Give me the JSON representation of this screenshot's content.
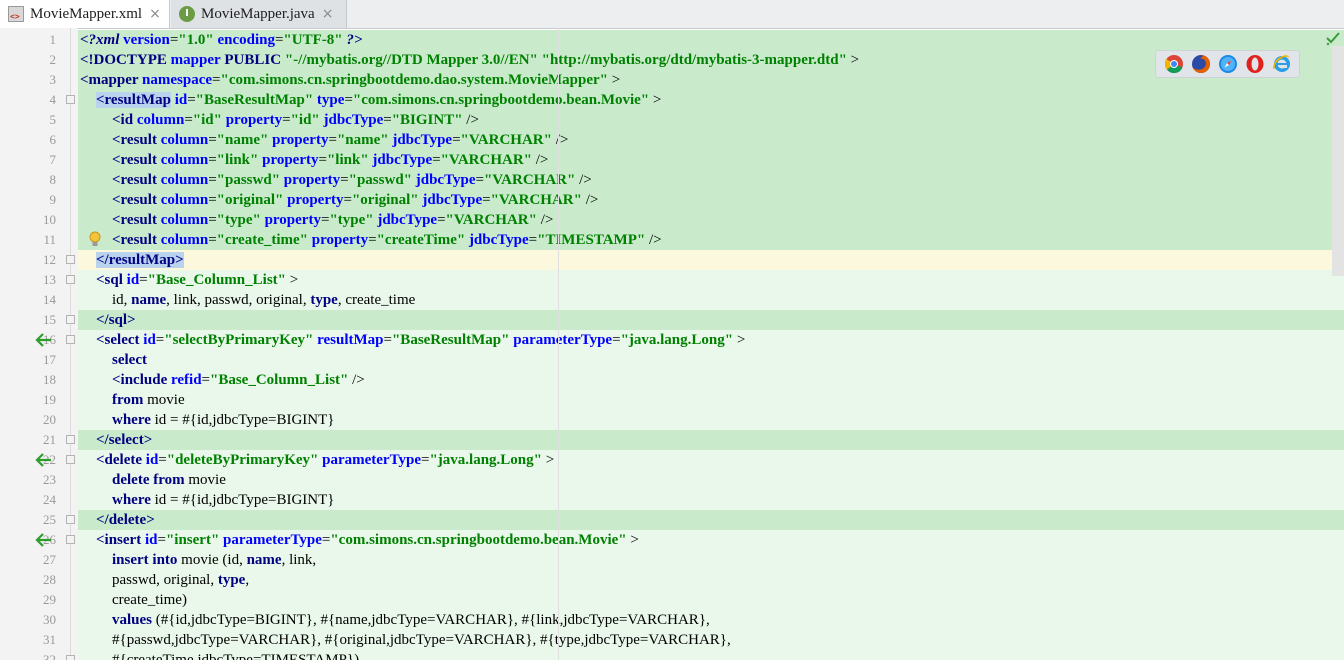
{
  "tabs": [
    {
      "label": "MovieMapper.xml",
      "icon": "xml-file-icon",
      "active": true
    },
    {
      "label": "MovieMapper.java",
      "icon": "java-interface-icon",
      "icon_letter": "I",
      "active": false
    }
  ],
  "close_glyph": "×",
  "browsers": [
    "chrome-icon",
    "firefox-icon",
    "safari-icon",
    "opera-icon",
    "ie-icon"
  ],
  "lines": [
    {
      "n": "1",
      "tokens": [
        [
          "pi",
          "<?xml "
        ],
        [
          "at",
          "version"
        ],
        [
          "pl",
          "="
        ],
        [
          "vl",
          "\"1.0\""
        ],
        [
          "pl",
          " "
        ],
        [
          "at",
          "encoding"
        ],
        [
          "pl",
          "="
        ],
        [
          "vl",
          "\"UTF-8\""
        ],
        [
          "pi",
          " ?>"
        ]
      ]
    },
    {
      "n": "2",
      "tokens": [
        [
          "tg",
          "<!DOCTYPE "
        ],
        [
          "at",
          "mapper"
        ],
        [
          "pl",
          " "
        ],
        [
          "tg",
          "PUBLIC"
        ],
        [
          "pl",
          " "
        ],
        [
          "vl",
          "\"-//mybatis.org//DTD Mapper 3.0//EN\""
        ],
        [
          "pl",
          " "
        ],
        [
          "vl",
          "\"http://mybatis.org/dtd/mybatis-3-mapper.dtd\""
        ],
        [
          "pl",
          " >"
        ]
      ]
    },
    {
      "n": "3",
      "tokens": [
        [
          "tg",
          "<mapper "
        ],
        [
          "at",
          "namespace"
        ],
        [
          "pl",
          "="
        ],
        [
          "vl",
          "\"com.simons.cn.springbootdemo.dao.system.MovieMapper\""
        ],
        [
          "pl",
          " >"
        ]
      ]
    },
    {
      "n": "4",
      "tokens": [
        [
          "tgh",
          "<resultMap"
        ],
        [
          "pl",
          " "
        ],
        [
          "at",
          "id"
        ],
        [
          "pl",
          "="
        ],
        [
          "vl",
          "\"BaseResultMap\""
        ],
        [
          "pl",
          " "
        ],
        [
          "at",
          "type"
        ],
        [
          "pl",
          "="
        ],
        [
          "vl",
          "\"com.simons.cn.springbootdemo.bean.Movie\""
        ],
        [
          "pl",
          " >"
        ]
      ]
    },
    {
      "n": "5",
      "tokens": [
        [
          "tg",
          "<id "
        ],
        [
          "at",
          "column"
        ],
        [
          "pl",
          "="
        ],
        [
          "vl",
          "\"id\""
        ],
        [
          "pl",
          " "
        ],
        [
          "at",
          "property"
        ],
        [
          "pl",
          "="
        ],
        [
          "vl",
          "\"id\""
        ],
        [
          "pl",
          " "
        ],
        [
          "at",
          "jdbcType"
        ],
        [
          "pl",
          "="
        ],
        [
          "vl",
          "\"BIGINT\""
        ],
        [
          "pl",
          " />"
        ]
      ]
    },
    {
      "n": "6",
      "tokens": [
        [
          "tg",
          "<result "
        ],
        [
          "at",
          "column"
        ],
        [
          "pl",
          "="
        ],
        [
          "vl",
          "\"name\""
        ],
        [
          "pl",
          " "
        ],
        [
          "at",
          "property"
        ],
        [
          "pl",
          "="
        ],
        [
          "vl",
          "\"name\""
        ],
        [
          "pl",
          " "
        ],
        [
          "at",
          "jdbcType"
        ],
        [
          "pl",
          "="
        ],
        [
          "vl",
          "\"VARCHAR\""
        ],
        [
          "pl",
          " />"
        ]
      ]
    },
    {
      "n": "7",
      "tokens": [
        [
          "tg",
          "<result "
        ],
        [
          "at",
          "column"
        ],
        [
          "pl",
          "="
        ],
        [
          "vl",
          "\"link\""
        ],
        [
          "pl",
          " "
        ],
        [
          "at",
          "property"
        ],
        [
          "pl",
          "="
        ],
        [
          "vl",
          "\"link\""
        ],
        [
          "pl",
          " "
        ],
        [
          "at",
          "jdbcType"
        ],
        [
          "pl",
          "="
        ],
        [
          "vl",
          "\"VARCHAR\""
        ],
        [
          "pl",
          " />"
        ]
      ]
    },
    {
      "n": "8",
      "tokens": [
        [
          "tg",
          "<result "
        ],
        [
          "at",
          "column"
        ],
        [
          "pl",
          "="
        ],
        [
          "vl",
          "\"passwd\""
        ],
        [
          "pl",
          " "
        ],
        [
          "at",
          "property"
        ],
        [
          "pl",
          "="
        ],
        [
          "vl",
          "\"passwd\""
        ],
        [
          "pl",
          " "
        ],
        [
          "at",
          "jdbcType"
        ],
        [
          "pl",
          "="
        ],
        [
          "vl",
          "\"VARCHAR\""
        ],
        [
          "pl",
          " />"
        ]
      ]
    },
    {
      "n": "9",
      "tokens": [
        [
          "tg",
          "<result "
        ],
        [
          "at",
          "column"
        ],
        [
          "pl",
          "="
        ],
        [
          "vl",
          "\"original\""
        ],
        [
          "pl",
          " "
        ],
        [
          "at",
          "property"
        ],
        [
          "pl",
          "="
        ],
        [
          "vl",
          "\"original\""
        ],
        [
          "pl",
          " "
        ],
        [
          "at",
          "jdbcType"
        ],
        [
          "pl",
          "="
        ],
        [
          "vl",
          "\"VARCHAR\""
        ],
        [
          "pl",
          " />"
        ]
      ]
    },
    {
      "n": "10",
      "tokens": [
        [
          "tg",
          "<result "
        ],
        [
          "at",
          "column"
        ],
        [
          "pl",
          "="
        ],
        [
          "vl",
          "\"type\""
        ],
        [
          "pl",
          " "
        ],
        [
          "at",
          "property"
        ],
        [
          "pl",
          "="
        ],
        [
          "vl",
          "\"type\""
        ],
        [
          "pl",
          " "
        ],
        [
          "at",
          "jdbcType"
        ],
        [
          "pl",
          "="
        ],
        [
          "vl",
          "\"VARCHAR\""
        ],
        [
          "pl",
          " />"
        ]
      ]
    },
    {
      "n": "11",
      "tokens": [
        [
          "tg",
          "<result "
        ],
        [
          "at",
          "column"
        ],
        [
          "pl",
          "="
        ],
        [
          "vl",
          "\"create_time\""
        ],
        [
          "pl",
          " "
        ],
        [
          "at",
          "property"
        ],
        [
          "pl",
          "="
        ],
        [
          "vl",
          "\"createTime\""
        ],
        [
          "pl",
          " "
        ],
        [
          "at",
          "jdbcType"
        ],
        [
          "pl",
          "="
        ],
        [
          "vl",
          "\"TIMESTAMP\""
        ],
        [
          "pl",
          " />"
        ]
      ]
    },
    {
      "n": "12",
      "tokens": [
        [
          "tgh",
          "</resultMap>"
        ]
      ]
    },
    {
      "n": "13",
      "tokens": [
        [
          "tg",
          "<sql "
        ],
        [
          "at",
          "id"
        ],
        [
          "pl",
          "="
        ],
        [
          "vl",
          "\"Base_Column_List\""
        ],
        [
          "pl",
          " >"
        ]
      ]
    },
    {
      "n": "14",
      "tokens": [
        [
          "pl",
          "id, "
        ],
        [
          "kw",
          "name"
        ],
        [
          "pl",
          ", link, passwd, original, "
        ],
        [
          "kw",
          "type"
        ],
        [
          "pl",
          ", create_time"
        ]
      ]
    },
    {
      "n": "15",
      "tokens": [
        [
          "tg",
          "</sql>"
        ]
      ]
    },
    {
      "n": "16",
      "tokens": [
        [
          "tg",
          "<select "
        ],
        [
          "at",
          "id"
        ],
        [
          "pl",
          "="
        ],
        [
          "vl",
          "\"selectByPrimaryKey\""
        ],
        [
          "pl",
          " "
        ],
        [
          "at",
          "resultMap"
        ],
        [
          "pl",
          "="
        ],
        [
          "vl",
          "\"BaseResultMap\""
        ],
        [
          "pl",
          " "
        ],
        [
          "at",
          "parameterType"
        ],
        [
          "pl",
          "="
        ],
        [
          "vl",
          "\"java.lang.Long\""
        ],
        [
          "pl",
          " >"
        ]
      ]
    },
    {
      "n": "17",
      "tokens": [
        [
          "kw",
          "select"
        ]
      ]
    },
    {
      "n": "18",
      "tokens": [
        [
          "tg",
          "<include "
        ],
        [
          "at",
          "refid"
        ],
        [
          "pl",
          "="
        ],
        [
          "vl",
          "\"Base_Column_List\""
        ],
        [
          "pl",
          " />"
        ]
      ]
    },
    {
      "n": "19",
      "tokens": [
        [
          "kw",
          "from"
        ],
        [
          "pl",
          " movie"
        ]
      ]
    },
    {
      "n": "20",
      "tokens": [
        [
          "kw",
          "where"
        ],
        [
          "pl",
          " id = #{id,jdbcType=BIGINT}"
        ]
      ]
    },
    {
      "n": "21",
      "tokens": [
        [
          "tg",
          "</select>"
        ]
      ]
    },
    {
      "n": "22",
      "tokens": [
        [
          "tg",
          "<delete "
        ],
        [
          "at",
          "id"
        ],
        [
          "pl",
          "="
        ],
        [
          "vl",
          "\"deleteByPrimaryKey\""
        ],
        [
          "pl",
          " "
        ],
        [
          "at",
          "parameterType"
        ],
        [
          "pl",
          "="
        ],
        [
          "vl",
          "\"java.lang.Long\""
        ],
        [
          "pl",
          " >"
        ]
      ]
    },
    {
      "n": "23",
      "tokens": [
        [
          "kw",
          "delete from"
        ],
        [
          "pl",
          " movie"
        ]
      ]
    },
    {
      "n": "24",
      "tokens": [
        [
          "kw",
          "where"
        ],
        [
          "pl",
          " id = #{id,jdbcType=BIGINT}"
        ]
      ]
    },
    {
      "n": "25",
      "tokens": [
        [
          "tg",
          "</delete>"
        ]
      ]
    },
    {
      "n": "26",
      "tokens": [
        [
          "tg",
          "<insert "
        ],
        [
          "at",
          "id"
        ],
        [
          "pl",
          "="
        ],
        [
          "vl",
          "\"insert\""
        ],
        [
          "pl",
          " "
        ],
        [
          "at",
          "parameterType"
        ],
        [
          "pl",
          "="
        ],
        [
          "vl",
          "\"com.simons.cn.springbootdemo.bean.Movie\""
        ],
        [
          "pl",
          " >"
        ]
      ]
    },
    {
      "n": "27",
      "tokens": [
        [
          "kw",
          "insert into"
        ],
        [
          "pl",
          " movie (id, "
        ],
        [
          "kw",
          "name"
        ],
        [
          "pl",
          ", link,"
        ]
      ]
    },
    {
      "n": "28",
      "tokens": [
        [
          "pl",
          "passwd, original, "
        ],
        [
          "kw",
          "type"
        ],
        [
          "pl",
          ","
        ]
      ]
    },
    {
      "n": "29",
      "tokens": [
        [
          "pl",
          "create_time)"
        ]
      ]
    },
    {
      "n": "30",
      "tokens": [
        [
          "kw",
          "values"
        ],
        [
          "pl",
          " (#{id,jdbcType=BIGINT}, #{name,jdbcType=VARCHAR}, #{link,jdbcType=VARCHAR},"
        ]
      ]
    },
    {
      "n": "31",
      "tokens": [
        [
          "pl",
          "#{passwd,jdbcType=VARCHAR}, #{original,jdbcType=VARCHAR}, #{type,jdbcType=VARCHAR},"
        ]
      ]
    },
    {
      "n": "32",
      "tokens": [
        [
          "pl",
          "#{createTime,jdbcType=TIMESTAMP})"
        ]
      ]
    }
  ]
}
